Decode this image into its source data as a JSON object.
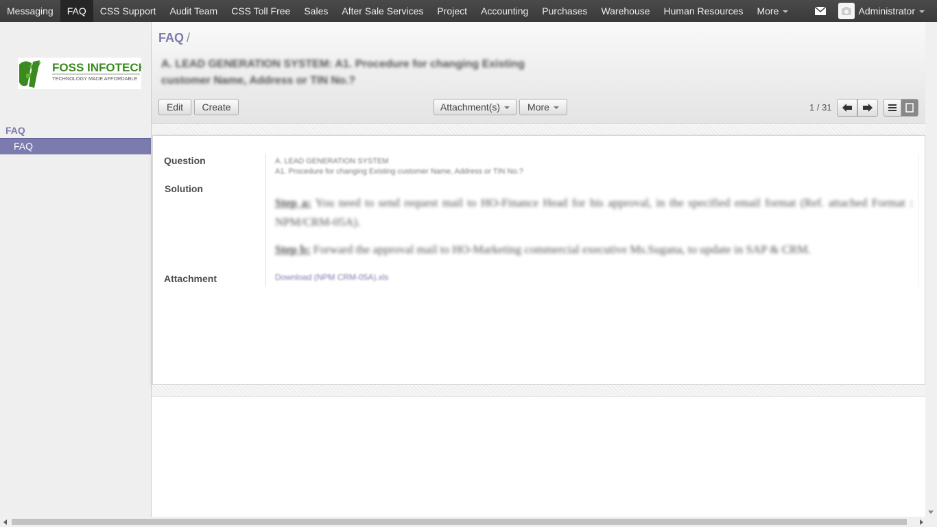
{
  "topbar": {
    "menu_items": [
      "Messaging",
      "FAQ",
      "CSS Support",
      "Audit Team",
      "CSS Toll Free",
      "Sales",
      "After Sale Services",
      "Project",
      "Accounting",
      "Purchases",
      "Warehouse",
      "Human Resources"
    ],
    "active_index": 1,
    "more_label": "More",
    "user_name": "Administrator",
    "mail_icon": "envelope-icon",
    "avatar_icon": "camera-icon"
  },
  "sidebar": {
    "logo": {
      "brand": "FOSS INFOTECH",
      "tagline": "TECHNOLOGY MADE AFFORDABLE",
      "brand_color": "#3a8a1f"
    },
    "heading": "FAQ",
    "items": [
      {
        "label": "FAQ",
        "active": true
      }
    ]
  },
  "control_panel": {
    "breadcrumb": "FAQ",
    "breadcrumb_sep": "/",
    "record_title": "A. LEAD GENERATION SYSTEM: A1. Procedure for changing Existing customer Name, Address or TIN No.?",
    "buttons": {
      "edit": "Edit",
      "create": "Create",
      "attachments": "Attachment(s)",
      "more": "More"
    },
    "pager": {
      "value": "1 / 31",
      "prev_icon": "arrow-left-icon",
      "next_icon": "arrow-right-icon"
    },
    "views": {
      "list_icon": "list-view-icon",
      "form_icon": "form-view-icon"
    }
  },
  "form": {
    "labels": {
      "question": "Question",
      "solution": "Solution",
      "attachment": "Attachment"
    },
    "question_lines": [
      "A. LEAD GENERATION SYSTEM",
      "A1. Procedure for changing Existing customer Name, Address or TIN No.?"
    ],
    "solution": {
      "step_a_label": "Step a:",
      "step_a_text": " You need to send request mail to HO-Finance Head for his approval, in the specified email format (Ref. attached Format : NPM/CRM-05A).",
      "step_b_label": "Step b:",
      "step_b_text": " Forward the approval mail to HO-Marketing commercial executive Ms.Sugana, to update in SAP & CRM."
    },
    "attachment_link": "Download (NPM CRM-05A).xls"
  },
  "colors": {
    "accent": "#7c7bad",
    "topbar": "#414141",
    "sidebar_bg": "#efeff0"
  }
}
